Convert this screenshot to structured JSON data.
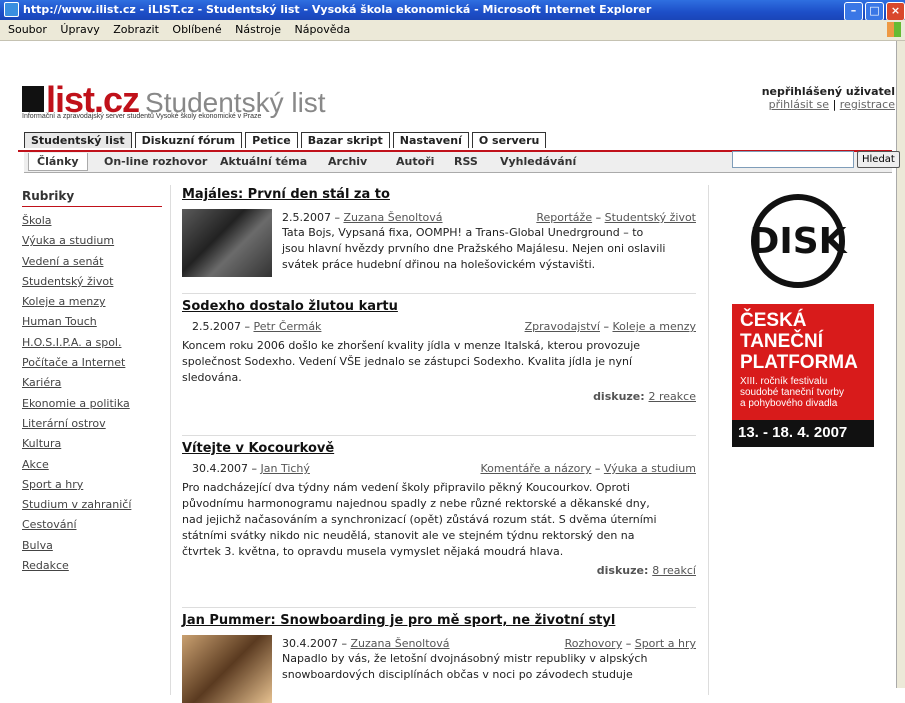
{
  "window": {
    "title": "http://www.ilist.cz - iLIST.cz - Studentský list - Vysoká škola ekonomická - Microsoft Internet Explorer"
  },
  "menu": [
    "Soubor",
    "Úpravy",
    "Zobrazit",
    "Oblíbené",
    "Nástroje",
    "Nápověda"
  ],
  "header": {
    "logo_black": "i",
    "logo_red": "list.cz",
    "logo_sub": "Studentský list",
    "tagline": "Informační a zpravodajský server studentů Vysoké školy ekonomické v Praze",
    "user_status": "nepřihlášený uživatel",
    "login": "přihlásit se",
    "separator": "|",
    "register": "registrace"
  },
  "tabs": [
    "Studentský list",
    "Diskuzní fórum",
    "Petice",
    "Bazar skript",
    "Nastavení",
    "O serveru"
  ],
  "subtabs": [
    "Články",
    "On-line rozhovor",
    "Aktuální téma",
    "Archiv",
    "Autoři",
    "RSS",
    "Vyhledávání"
  ],
  "search": {
    "button": "Hledat",
    "value": ""
  },
  "sidebar": {
    "heading": "Rubriky",
    "items": [
      "Škola",
      "Výuka a studium",
      "Vedení a senát",
      "Studentský život",
      "Koleje a menzy",
      "Human Touch",
      "H.O.S.I.P.A. a spol.",
      "Počítače a Internet",
      "Kariéra",
      "Ekonomie a politika",
      "Literární ostrov",
      "Kultura",
      "Akce",
      "Sport a hry",
      "Studium v zahraničí",
      "Cestování",
      "Bulva",
      "Redakce"
    ]
  },
  "articles": [
    {
      "title": "Majáles: První den stál za to",
      "date": "2.5.2007 –",
      "author": "Zuzana Šenoltová",
      "cat1": "Reportáže",
      "dash": "–",
      "cat2": "Studentský život",
      "lines": [
        "Tata Bojs, Vypsaná fixa, OOMPH! a Trans-Global Unedrground – to",
        "jsou hlavní hvězdy prvního dne Pražského Majálesu. Nejen oni oslavili",
        "svátek práce hudební dřinou na holešovickém výstavišti."
      ]
    },
    {
      "title": "Sodexho dostalo žlutou kartu",
      "date": "2.5.2007 –",
      "author": "Petr Čermák",
      "cat1": "Zpravodajství",
      "dash": "–",
      "cat2": "Koleje a menzy",
      "lines": [
        "Koncem roku 2006 došlo ke zhoršení kvality jídla v menze Italská, kterou provozuje",
        "společnost Sodexho. Vedení VŠE jednalo se zástupci Sodexho. Kvalita jídla je nyní",
        "sledována."
      ],
      "disk_label": "diskuze:",
      "disk_link": "2 reakce"
    },
    {
      "title": "Vítejte v Kocourkově",
      "date": "30.4.2007 –",
      "author": "Jan Tichý",
      "cat1": "Komentáře a názory",
      "dash": "–",
      "cat2": "Výuka a studium",
      "lines": [
        "Pro nadcházející dva týdny nám vedení školy připravilo pěkný Koucourkov. Oproti",
        "původnímu harmonogramu najednou spadly z nebe různé rektorské a děkanské dny,",
        "nad jejichž načasováním a synchronizací (opět) zůstává rozum stát. S dvěma úterními",
        "státními svátky nikdo nic neudělá, stanovit ale ve stejném týdnu rektorský den na",
        "čtvrtek 3. května, to opravdu musela vymyslet nějaká moudrá hlava."
      ],
      "disk_label": "diskuze:",
      "disk_link": "8 reakcí"
    },
    {
      "title": "Jan Pummer: Snowboarding je pro mě sport, ne životní styl",
      "date": "30.4.2007 –",
      "author": "Zuzana Šenoltová",
      "cat1": "Rozhovory",
      "dash": "–",
      "cat2": "Sport a hry",
      "lines": [
        "Napadlo by vás, že letošní dvojnásobný mistr republiky v alpských",
        "snowboardových disciplínách občas v noci po závodech studuje"
      ]
    }
  ],
  "ad": {
    "line1": "ČESKÁ",
    "line2": "TANEČNÍ",
    "line3": "PLATFORMA",
    "sub1": "XIII. ročník festivalu",
    "sub2": "soudobé taneční tvorby",
    "sub3": "a pohybového divadla",
    "dates": "13. - 18. 4. 2007"
  },
  "colors": {
    "accent": "#c0111a",
    "titlebar": "#1d4fc8",
    "ad_bg": "#d81b1b"
  }
}
